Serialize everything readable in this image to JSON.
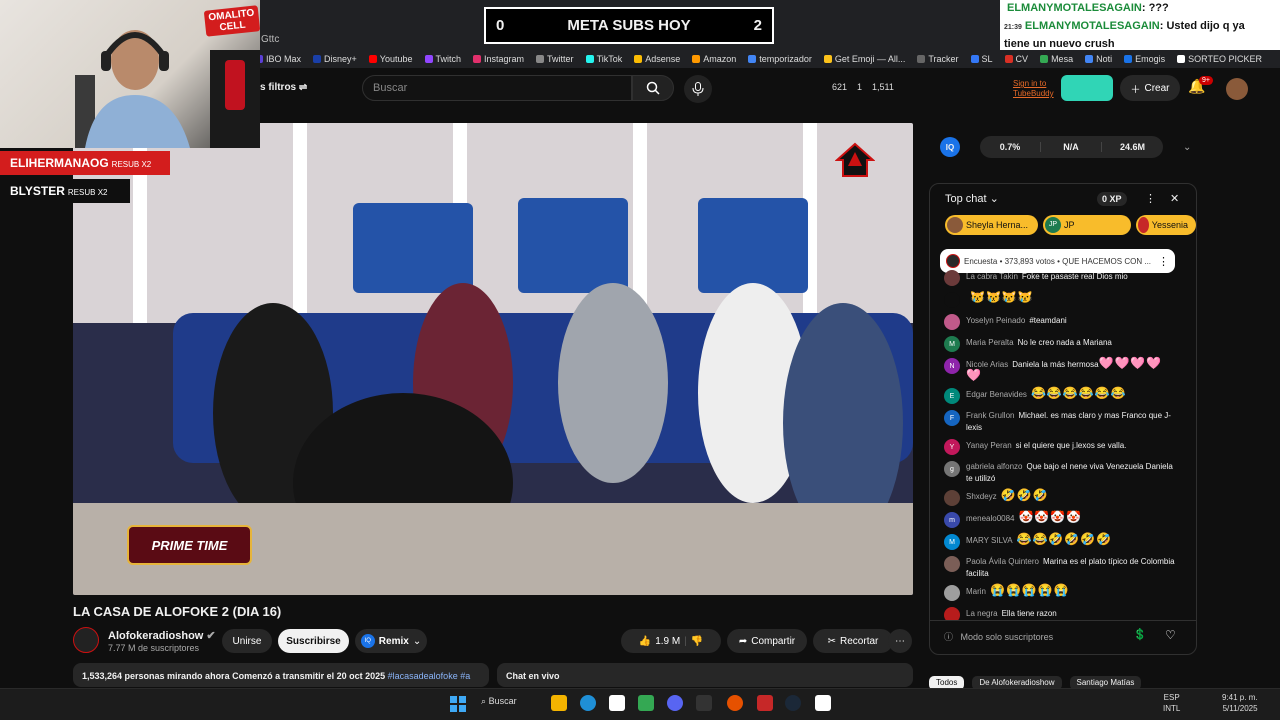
{
  "browser": {
    "url_fragment": "Gttc",
    "bookmarks": [
      {
        "label": "IBO Max",
        "color": "#5b3fd6"
      },
      {
        "label": "Disney+",
        "color": "#1a3fa8"
      },
      {
        "label": "Youtube",
        "color": "#ff0000"
      },
      {
        "label": "Twitch",
        "color": "#9146ff"
      },
      {
        "label": "Instagram",
        "color": "#e1306c"
      },
      {
        "label": "Twitter",
        "color": "#888888"
      },
      {
        "label": "TikTok",
        "color": "#25f4ee"
      },
      {
        "label": "Adsense",
        "color": "#fbbc04"
      },
      {
        "label": "Amazon",
        "color": "#ff9900"
      },
      {
        "label": "temporizador",
        "color": "#4285f4"
      },
      {
        "label": "Get Emoji — All...",
        "color": "#fcc21b"
      },
      {
        "label": "Tracker",
        "color": "#666666"
      },
      {
        "label": "SL",
        "color": "#3478f6"
      },
      {
        "label": "CV",
        "color": "#d93025"
      },
      {
        "label": "Mesa",
        "color": "#34a853"
      },
      {
        "label": "Noti",
        "color": "#4285f4"
      },
      {
        "label": "Emogis",
        "color": "#1a73e8"
      },
      {
        "label": "SORTEO PICKER",
        "color": "#ffffff"
      }
    ]
  },
  "header": {
    "filters_label": "s filtros",
    "search_placeholder": "Buscar",
    "stats": [
      "621",
      "1",
      "1,511"
    ],
    "tubebuddy_line1": "Sign in to",
    "tubebuddy_line2": "TubeBuddy",
    "create_label": "Crear",
    "notif_badge": "9+"
  },
  "stream_overlay": {
    "webcam_logo_line1": "OMALITO",
    "webcam_logo_line2": "CELL",
    "meta": {
      "left": "0",
      "title": "META SUBS HOY",
      "right": "2"
    },
    "top_chat": [
      {
        "time": "",
        "name": "ELMANYMOTALESAGAIN",
        "text": ": ???"
      },
      {
        "time": "21:39",
        "name": "ELMANYMOTALESAGAIN",
        "text": ": Usted dijo q ya"
      },
      {
        "time": "",
        "name": "",
        "text": "tiene un nuevo crush"
      }
    ],
    "resubs": [
      {
        "name": "ELIHERMANAOG",
        "tag": "RESUB X2",
        "bg": "#d31d1d"
      },
      {
        "name": "BLYSTER",
        "tag": "RESUB X2",
        "bg": "#0f0f0f"
      }
    ],
    "primetime_label": "PRIME TIME"
  },
  "video": {
    "title": "LA CASA DE ALOFOKE 2 (DIA 16)",
    "channel": "Alofokeradioshow",
    "subscribers": "7.77 M de suscriptores",
    "join_label": "Unirse",
    "subscribe_label": "Suscribirse",
    "remix_label": "Remix",
    "likes": "1.9 M",
    "share_label": "Compartir",
    "cut_label": "Recortar",
    "description": "1,533,264 personas mirando ahora  Comenzó a transmitir el 20 oct 2025 ",
    "hashtag": "#lacasadealofoke #a",
    "chat_en_vivo_label": "Chat en vivo"
  },
  "iq_bar": {
    "badge": "IQ",
    "values": [
      "0.7%",
      "N/A",
      "24.6M"
    ]
  },
  "chat": {
    "header": "Top chat",
    "xp": "0 XP",
    "chips": [
      {
        "label": "Sheyla Herna...",
        "initials": ""
      },
      {
        "label": "JP",
        "initials": "JP"
      },
      {
        "label": "Yessenia",
        "initials": ""
      }
    ],
    "poll": "Encuesta • 373,893 votos • QUE HACEMOS CON ...",
    "messages": [
      {
        "avatar": "",
        "color": "#6b3a3a",
        "name": "La cabra Takin",
        "text": "Foke te pasaste real Dios mio",
        "emoji": ""
      },
      {
        "avatar": "",
        "color": "#0f0f0f",
        "name": "",
        "text": "",
        "emoji": "😿😿😿😿"
      },
      {
        "avatar": "",
        "color": "#c05a8a",
        "name": "Yoselyn Peinado",
        "text": "#teamdani",
        "emoji": ""
      },
      {
        "avatar": "M",
        "color": "#1e7b4f",
        "name": "Maria Peralta",
        "text": "No le creo nada a Mariana",
        "emoji": ""
      },
      {
        "avatar": "N",
        "color": "#8e24aa",
        "name": "Nicole Arias",
        "text": "Daniela la más hermosa",
        "emoji": "🩷🩷🩷🩷🩷"
      },
      {
        "avatar": "E",
        "color": "#00897b",
        "name": "Edgar Benavides",
        "text": "",
        "emoji": "😂😂😂😂😂😂"
      },
      {
        "avatar": "F",
        "color": "#1565c0",
        "name": "Frank Grullon",
        "text": "Michael. es mas claro y mas Franco que J-lexis",
        "emoji": ""
      },
      {
        "avatar": "Y",
        "color": "#c2185b",
        "name": "Yanay Peran",
        "text": "si el quiere que j.lexos se valla.",
        "emoji": ""
      },
      {
        "avatar": "g",
        "color": "#757575",
        "name": "gabriela alfonzo",
        "text": "Que bajo el nene viva Venezuela Daniela te utilizó",
        "emoji": ""
      },
      {
        "avatar": "",
        "color": "#5d4037",
        "name": "Shxdeyz",
        "text": "",
        "emoji": "🤣🤣🤣"
      },
      {
        "avatar": "m",
        "color": "#3949ab",
        "name": "menealo0084",
        "text": "",
        "emoji": "🤡🤡🤡🤡"
      },
      {
        "avatar": "M",
        "color": "#0288d1",
        "name": "MARY SILVA",
        "text": "",
        "emoji": "😂😂🤣🤣🤣🤣"
      },
      {
        "avatar": "",
        "color": "#7b5e57",
        "name": "Paola Ávila Quintero",
        "text": "Marina es el plato típico de Colombia facilita",
        "emoji": ""
      },
      {
        "avatar": "",
        "color": "#9e9e9e",
        "name": "Marin",
        "text": "",
        "emoji": "😭😭😭😭😭"
      },
      {
        "avatar": "",
        "color": "#b71c1c",
        "name": "La negra",
        "text": "Ella tiene razon",
        "emoji": ""
      }
    ],
    "input_placeholder": "Modo solo suscriptores",
    "bottom_tabs": [
      "Todos",
      "De Alofokeradioshow",
      "Santiago Matías"
    ]
  },
  "taskbar": {
    "search_label": "Buscar",
    "lang_line1": "ESP",
    "lang_line2": "INTL",
    "time": "9:41 p. m.",
    "date": "5/11/2025"
  }
}
